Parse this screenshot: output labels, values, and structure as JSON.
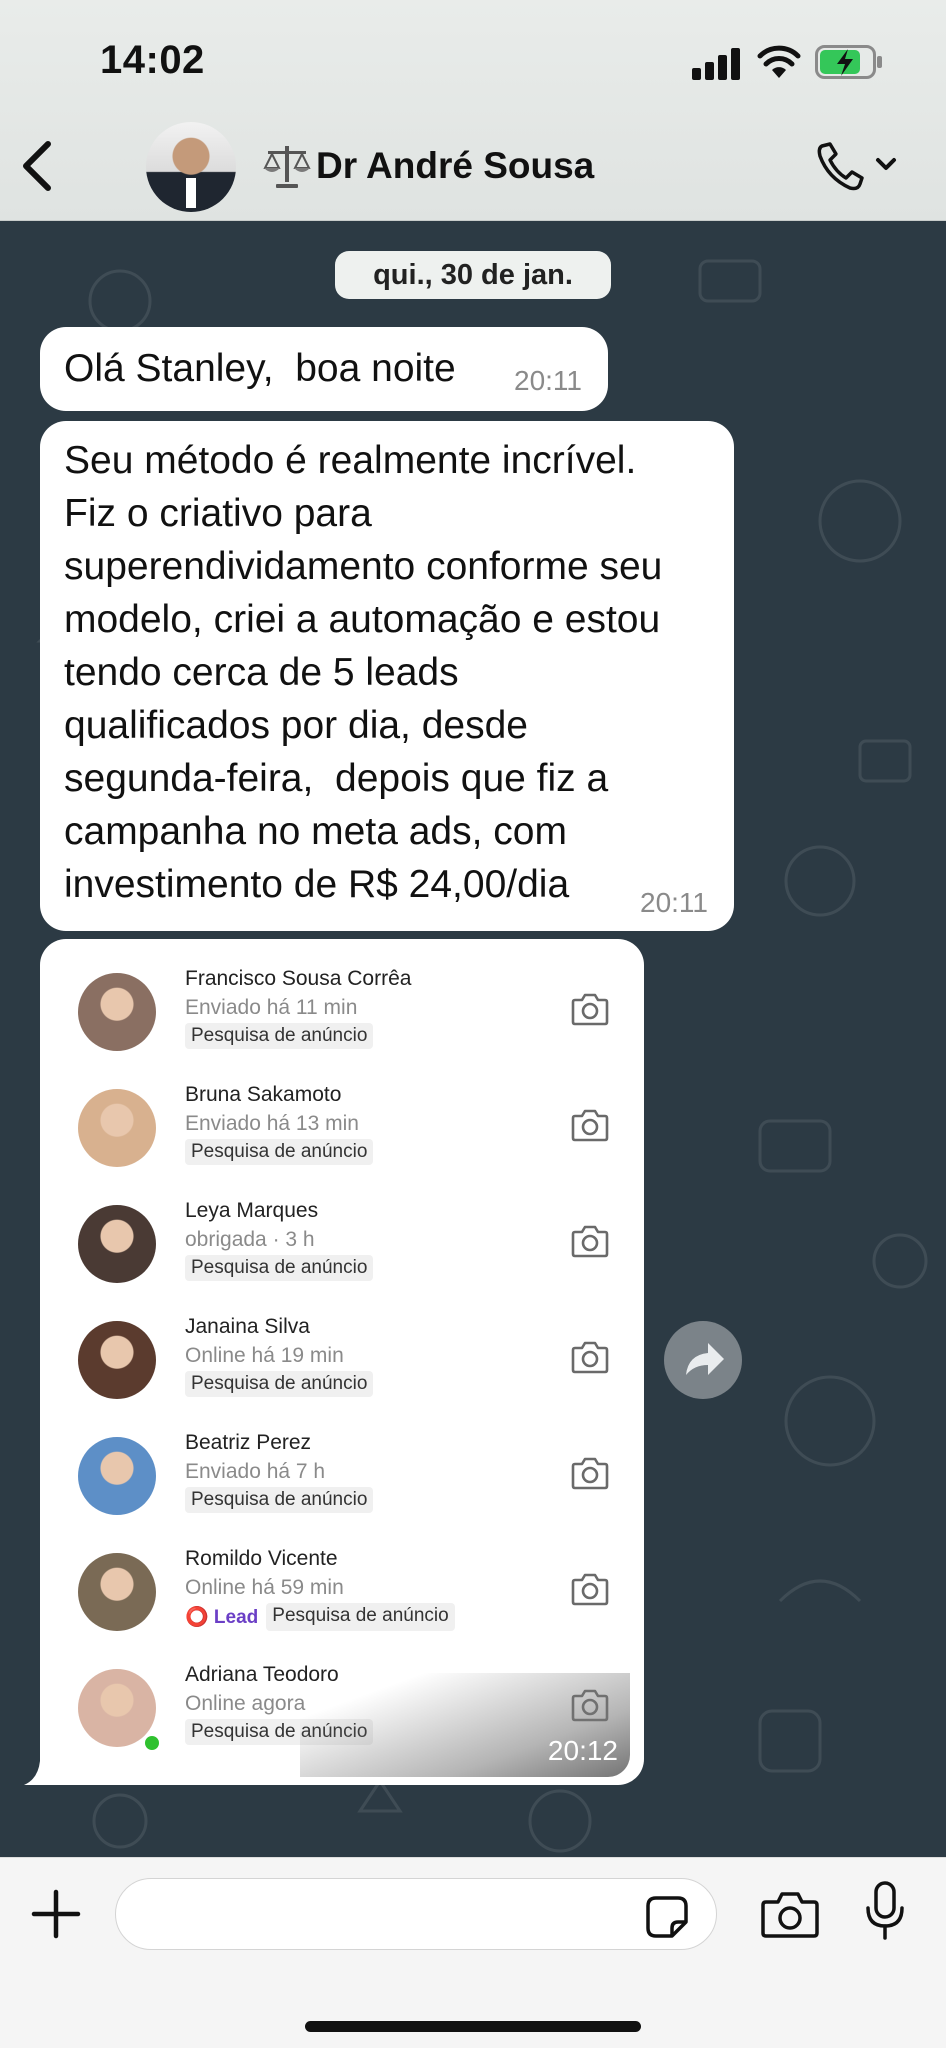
{
  "status_bar": {
    "time": "14:02"
  },
  "header": {
    "contact_name": "Dr André Sousa"
  },
  "chat": {
    "date_label": "qui., 30 de jan.",
    "message1": {
      "text": "Olá Stanley,  boa noite",
      "time": "20:11"
    },
    "message2": {
      "lines": [
        "Seu método é realmente incrível.",
        "Fiz o criativo para",
        "superendividamento conforme seu",
        "modelo, criei a automação e estou",
        "tendo cerca de 5 leads",
        "qualificados por dia, desde",
        "segunda-feira,  depois que fiz a",
        "campanha no meta ads, com",
        "investimento de R$ 24,00/dia"
      ],
      "time": "20:11"
    },
    "message3": {
      "time": "20:12",
      "leads": [
        {
          "name": "Francisco Sousa Corrêa",
          "status": "Enviado há 11 min",
          "tags": [
            "Pesquisa de anúncio"
          ],
          "color": "#8a6f62"
        },
        {
          "name": "Bruna Sakamoto",
          "status": "Enviado há 13 min",
          "tags": [
            "Pesquisa de anúncio"
          ],
          "color": "#d8b18f"
        },
        {
          "name": "Leya Marques",
          "status": "obrigada · 3 h",
          "tags": [
            "Pesquisa de anúncio"
          ],
          "color": "#4a3a34"
        },
        {
          "name": "Janaina Silva",
          "status": "Online há 19 min",
          "tags": [
            "Pesquisa de anúncio"
          ],
          "color": "#5b3b2e"
        },
        {
          "name": "Beatriz Perez",
          "status": "Enviado há 7 h",
          "tags": [
            "Pesquisa de anúncio"
          ],
          "color": "#5d8fc7"
        },
        {
          "name": "Romildo Vicente",
          "status": "Online há 59 min",
          "tags": [
            "Lead",
            "Pesquisa de anúncio"
          ],
          "color": "#7a6a55"
        },
        {
          "name": "Adriana Teodoro",
          "status": "Online agora",
          "tags": [
            "Pesquisa de anúncio"
          ],
          "color": "#d9b4a4"
        }
      ]
    }
  }
}
